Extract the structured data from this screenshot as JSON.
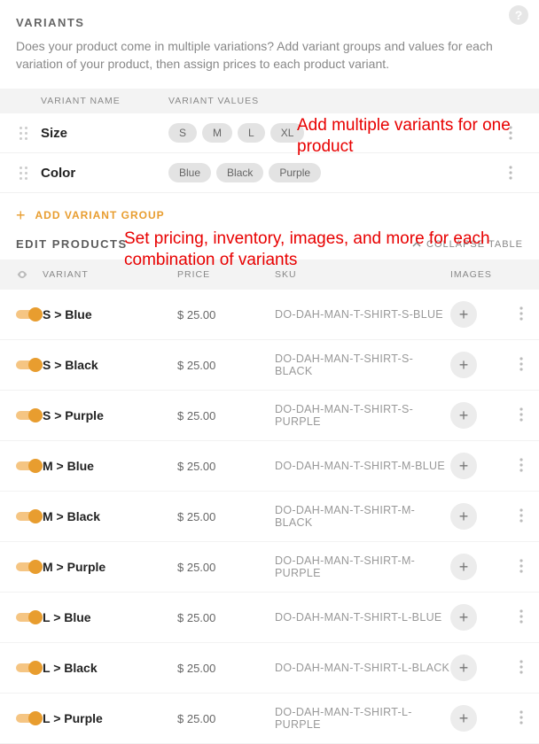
{
  "section": {
    "title": "VARIANTS",
    "description": "Does your product come in multiple variations? Add variant groups and values for each variation of your product, then assign prices to each product variant."
  },
  "headers": {
    "name": "VARIANT NAME",
    "values": "VARIANT VALUES"
  },
  "variant_groups": [
    {
      "name": "Size",
      "values": [
        "S",
        "M",
        "L",
        "XL"
      ]
    },
    {
      "name": "Color",
      "values": [
        "Blue",
        "Black",
        "Purple"
      ]
    }
  ],
  "add_group_label": "ADD VARIANT GROUP",
  "edit_products": {
    "title": "EDIT PRODUCTS",
    "collapse_label": "COLLAPSE TABLE",
    "columns": {
      "variant": "VARIANT",
      "price": "PRICE",
      "sku": "SKU",
      "images": "IMAGES"
    }
  },
  "products": [
    {
      "variant": "S > Blue",
      "price": "$ 25.00",
      "sku": "DO-DAH-MAN-T-SHIRT-S-BLUE"
    },
    {
      "variant": "S > Black",
      "price": "$ 25.00",
      "sku": "DO-DAH-MAN-T-SHIRT-S-BLACK"
    },
    {
      "variant": "S > Purple",
      "price": "$ 25.00",
      "sku": "DO-DAH-MAN-T-SHIRT-S-PURPLE"
    },
    {
      "variant": "M > Blue",
      "price": "$ 25.00",
      "sku": "DO-DAH-MAN-T-SHIRT-M-BLUE"
    },
    {
      "variant": "M > Black",
      "price": "$ 25.00",
      "sku": "DO-DAH-MAN-T-SHIRT-M-BLACK"
    },
    {
      "variant": "M > Purple",
      "price": "$ 25.00",
      "sku": "DO-DAH-MAN-T-SHIRT-M-PURPLE"
    },
    {
      "variant": "L > Blue",
      "price": "$ 25.00",
      "sku": "DO-DAH-MAN-T-SHIRT-L-BLUE"
    },
    {
      "variant": "L > Black",
      "price": "$ 25.00",
      "sku": "DO-DAH-MAN-T-SHIRT-L-BLACK"
    },
    {
      "variant": "L > Purple",
      "price": "$ 25.00",
      "sku": "DO-DAH-MAN-T-SHIRT-L-PURPLE"
    }
  ],
  "annotations": {
    "a1": "Add multiple variants for one product",
    "a2": "Set pricing, inventory, images, and more for each combination of variants"
  }
}
